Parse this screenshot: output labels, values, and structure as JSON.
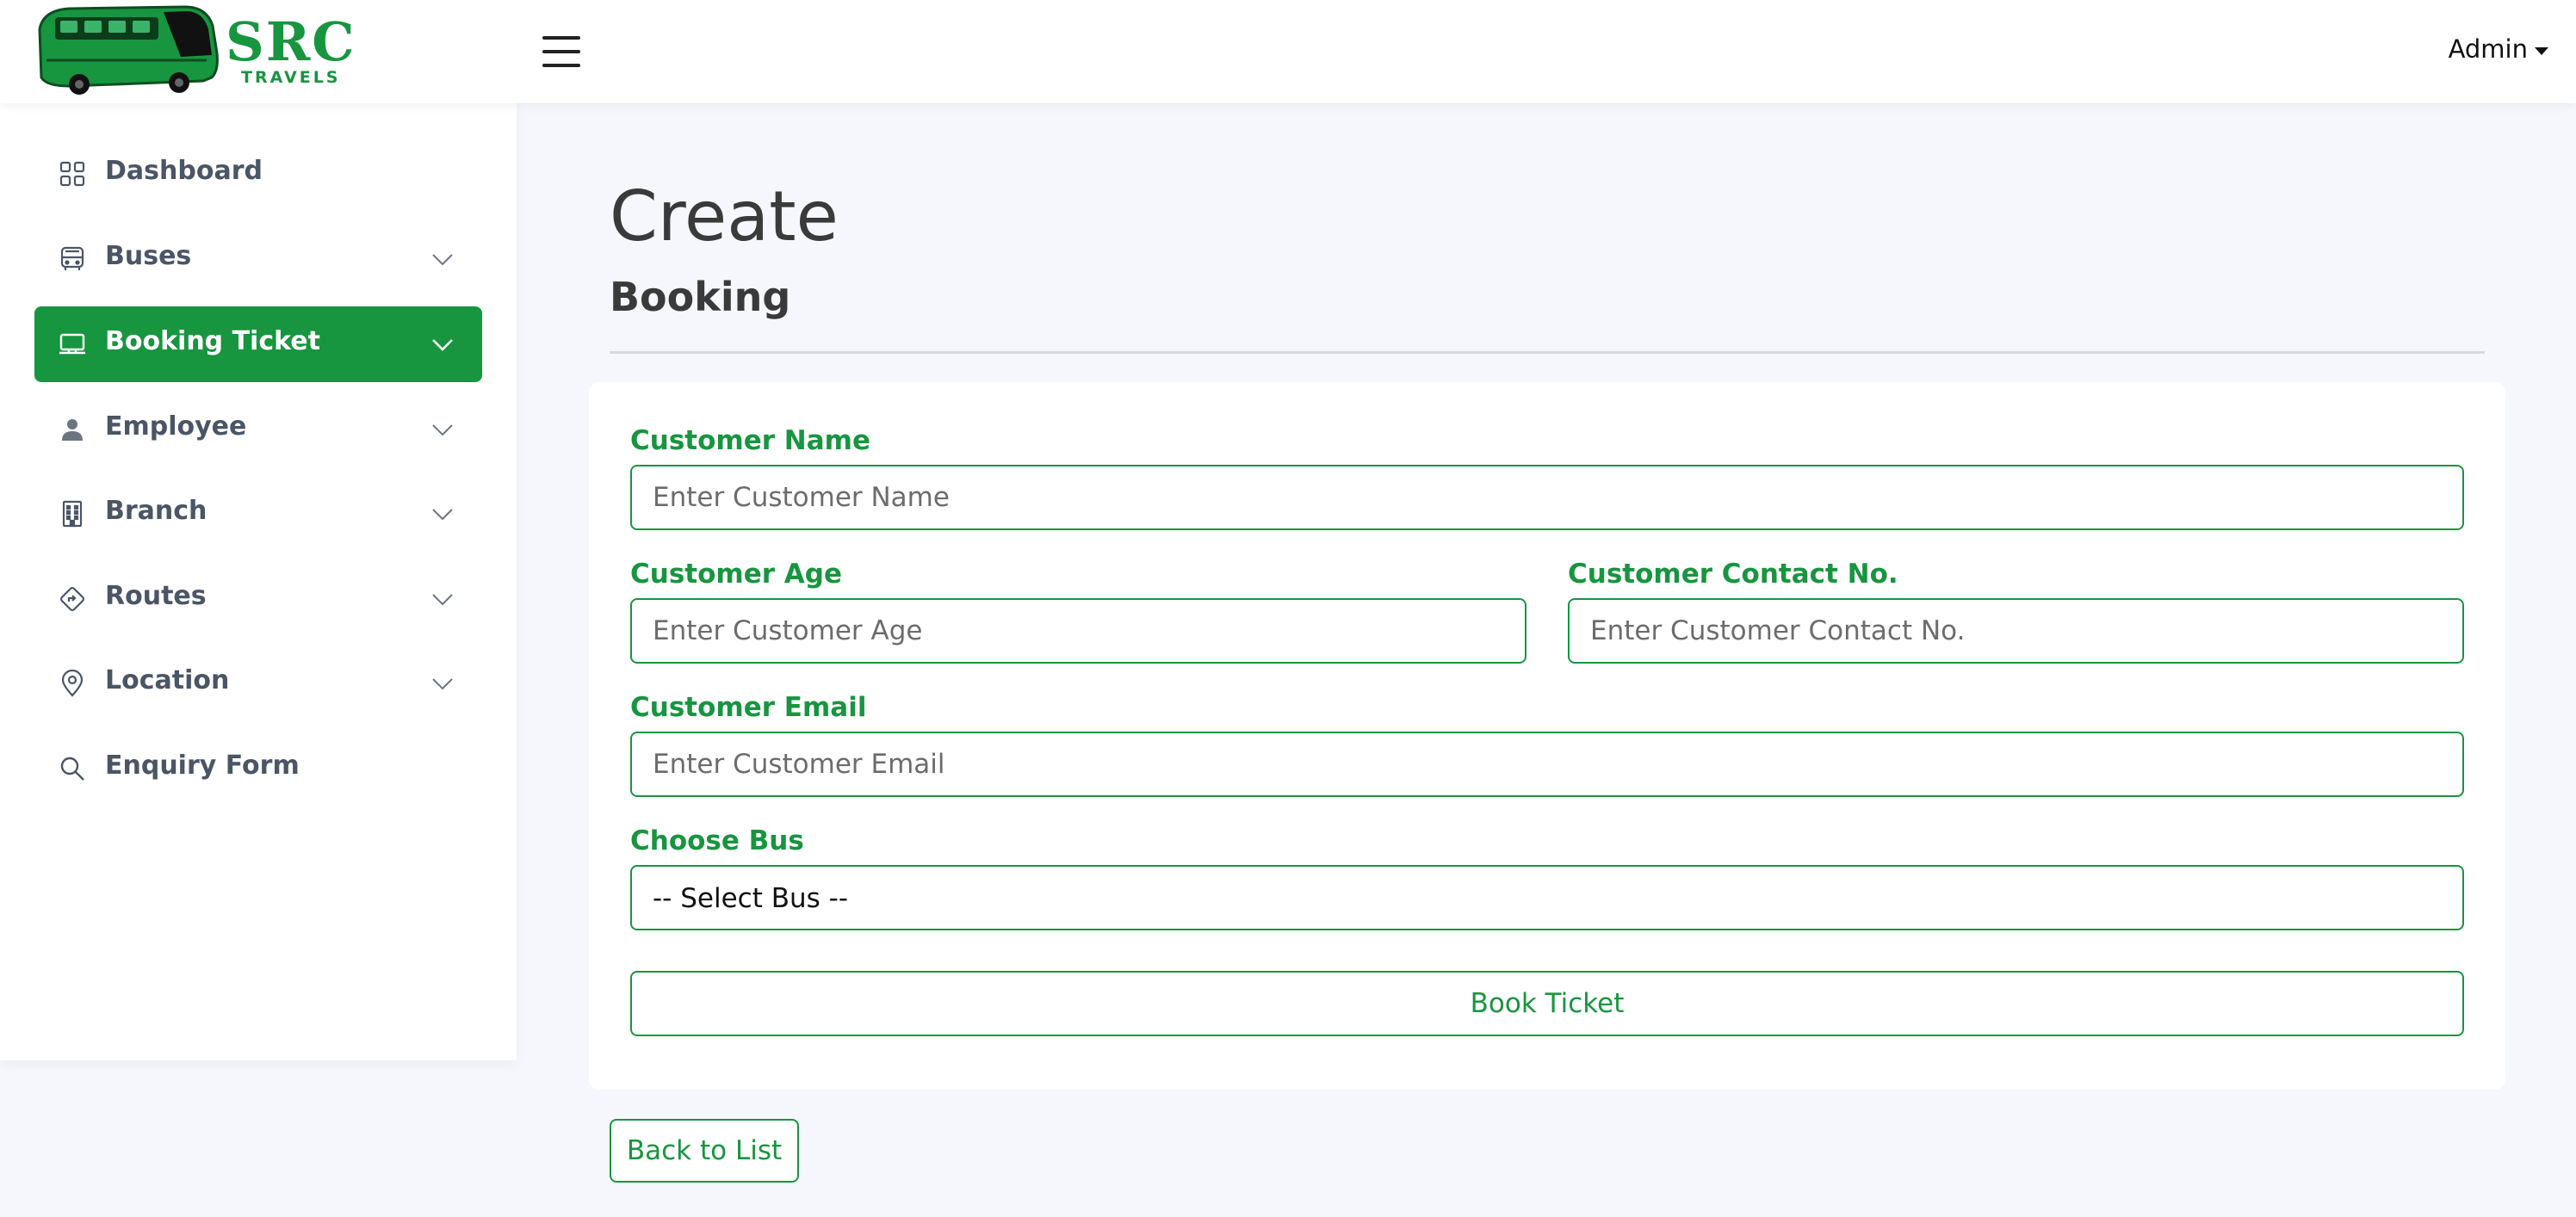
{
  "brand": {
    "name": "SRC",
    "tagline": "TRAVELS",
    "color": "#17953f"
  },
  "header": {
    "menu_icon": "hamburger-menu-icon",
    "user_label": "Admin"
  },
  "sidebar": {
    "items": [
      {
        "label": "Dashboard",
        "icon": "dashboard-grid-icon",
        "expandable": false,
        "active": false
      },
      {
        "label": "Buses",
        "icon": "bus-icon",
        "expandable": true,
        "active": false
      },
      {
        "label": "Booking Ticket",
        "icon": "laptop-icon",
        "expandable": true,
        "active": true
      },
      {
        "label": "Employee",
        "icon": "person-icon",
        "expandable": true,
        "active": false
      },
      {
        "label": "Branch",
        "icon": "building-icon",
        "expandable": true,
        "active": false
      },
      {
        "label": "Routes",
        "icon": "route-sign-icon",
        "expandable": true,
        "active": false
      },
      {
        "label": "Location",
        "icon": "map-pin-icon",
        "expandable": true,
        "active": false
      },
      {
        "label": "Enquiry Form",
        "icon": "search-icon",
        "expandable": false,
        "active": false
      }
    ]
  },
  "page": {
    "title": "Create",
    "subtitle": "Booking"
  },
  "form": {
    "customer_name": {
      "label": "Customer Name",
      "placeholder": "Enter Customer Name",
      "value": ""
    },
    "customer_age": {
      "label": "Customer Age",
      "placeholder": "Enter Customer Age",
      "value": ""
    },
    "customer_contact": {
      "label": "Customer Contact No.",
      "placeholder": "Enter Customer Contact No.",
      "value": ""
    },
    "customer_email": {
      "label": "Customer Email",
      "placeholder": "Enter Customer Email",
      "value": ""
    },
    "choose_bus": {
      "label": "Choose Bus",
      "selected": "-- Select Bus --"
    },
    "submit_label": "Book Ticket"
  },
  "back_link": "Back to List"
}
